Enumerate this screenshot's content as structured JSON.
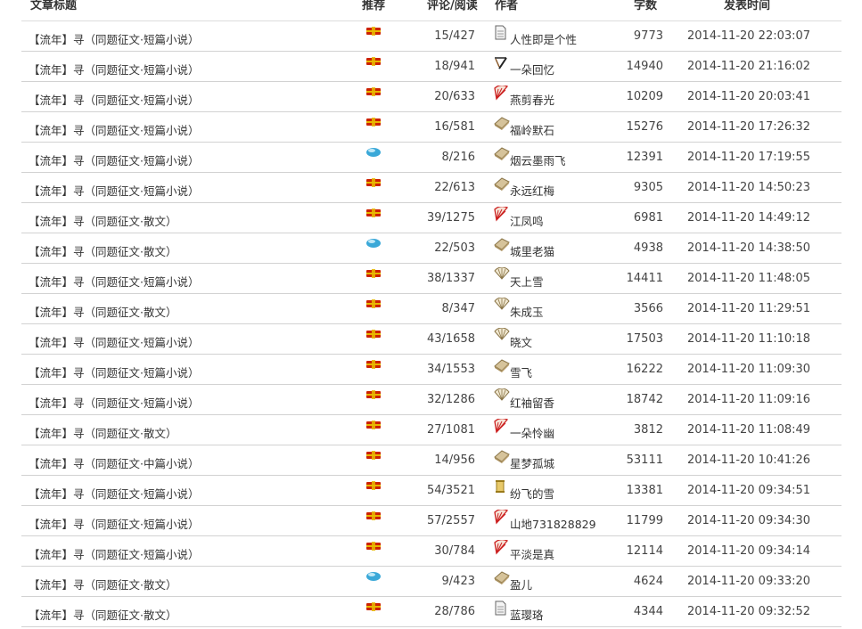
{
  "header": {
    "col_title": "文章标题",
    "col_recommend": "推荐",
    "col_comments_reads": "评论/阅读",
    "col_author": "作者",
    "col_words": "字数",
    "col_time": "发表时间"
  },
  "colors": {
    "row_border": "#d2d2d2",
    "text": "#333333",
    "recommend_red": "#cc2200",
    "recommend_gold": "#e8b800",
    "recommend_blue": "#3aa8d8"
  },
  "rows": [
    {
      "title": "【流年】寻（同题征文·短篇小说）",
      "rec": "red-bar-icon",
      "cr": "15/427",
      "author_icon": "document-icon",
      "author": "人性即是个性",
      "words": "9773",
      "time": "2014-11-20 22:03:07"
    },
    {
      "title": "【流年】寻（同题征文·短篇小说）",
      "rec": "red-bar-icon",
      "cr": "18/941",
      "author_icon": "brush-icon",
      "author": "一朵回忆",
      "words": "14940",
      "time": "2014-11-20 21:16:02"
    },
    {
      "title": "【流年】寻（同题征文·短篇小说）",
      "rec": "red-bar-icon",
      "cr": "20/633",
      "author_icon": "red-fan-icon",
      "author": "燕剪春光",
      "words": "10209",
      "time": "2014-11-20 20:03:41"
    },
    {
      "title": "【流年】寻（同题征文·短篇小说）",
      "rec": "red-bar-icon",
      "cr": "16/581",
      "author_icon": "book-icon",
      "author": "福岭默石",
      "words": "15276",
      "time": "2014-11-20 17:26:32"
    },
    {
      "title": "【流年】寻（同题征文·短篇小说）",
      "rec": "blue-gem-icon",
      "cr": "8/216",
      "author_icon": "book-icon",
      "author": "烟云墨雨飞",
      "words": "12391",
      "time": "2014-11-20 17:19:55"
    },
    {
      "title": "【流年】寻（同题征文·短篇小说）",
      "rec": "red-bar-icon",
      "cr": "22/613",
      "author_icon": "book-icon",
      "author": "永远红梅",
      "words": "9305",
      "time": "2014-11-20 14:50:23"
    },
    {
      "title": "【流年】寻（同题征文·散文）",
      "rec": "red-bar-icon",
      "cr": "39/1275",
      "author_icon": "red-fan-icon",
      "author": "江凤鸣",
      "words": "6981",
      "time": "2014-11-20 14:49:12"
    },
    {
      "title": "【流年】寻（同题征文·散文）",
      "rec": "blue-gem-icon",
      "cr": "22/503",
      "author_icon": "book-icon",
      "author": "城里老猫",
      "words": "4938",
      "time": "2014-11-20 14:38:50"
    },
    {
      "title": "【流年】寻（同题征文·短篇小说）",
      "rec": "red-bar-icon",
      "cr": "38/1337",
      "author_icon": "paper-fan-icon",
      "author": "天上雪",
      "words": "14411",
      "time": "2014-11-20 11:48:05"
    },
    {
      "title": "【流年】寻（同题征文·散文）",
      "rec": "red-bar-icon",
      "cr": "8/347",
      "author_icon": "paper-fan-icon",
      "author": "朱成玉",
      "words": "3566",
      "time": "2014-11-20 11:29:51"
    },
    {
      "title": "【流年】寻（同题征文·短篇小说）",
      "rec": "red-bar-icon",
      "cr": "43/1658",
      "author_icon": "paper-fan-icon",
      "author": "晓文",
      "words": "17503",
      "time": "2014-11-20 11:10:18"
    },
    {
      "title": "【流年】寻（同题征文·短篇小说）",
      "rec": "red-bar-icon",
      "cr": "34/1553",
      "author_icon": "book-icon",
      "author": "雪飞",
      "words": "16222",
      "time": "2014-11-20 11:09:30"
    },
    {
      "title": "【流年】寻（同题征文·短篇小说）",
      "rec": "red-bar-icon",
      "cr": "32/1286",
      "author_icon": "paper-fan-icon",
      "author": "红袖留香",
      "words": "18742",
      "time": "2014-11-20 11:09:16"
    },
    {
      "title": "【流年】寻（同题征文·散文）",
      "rec": "red-bar-icon",
      "cr": "27/1081",
      "author_icon": "red-fan-icon",
      "author": "一朵怜幽",
      "words": "3812",
      "time": "2014-11-20 11:08:49"
    },
    {
      "title": "【流年】寻（同题征文·中篇小说）",
      "rec": "red-bar-icon",
      "cr": "14/956",
      "author_icon": "book-icon",
      "author": "星梦孤城",
      "words": "53111",
      "time": "2014-11-20 10:41:26"
    },
    {
      "title": "【流年】寻（同题征文·短篇小说）",
      "rec": "red-bar-icon",
      "cr": "54/3521",
      "author_icon": "scroll-icon",
      "author": "纷飞的雪",
      "words": "13381",
      "time": "2014-11-20 09:34:51"
    },
    {
      "title": "【流年】寻（同题征文·短篇小说）",
      "rec": "red-bar-icon",
      "cr": "57/2557",
      "author_icon": "red-fan-icon",
      "author": "山地731828829",
      "words": "11799",
      "time": "2014-11-20 09:34:30"
    },
    {
      "title": "【流年】寻（同题征文·短篇小说）",
      "rec": "red-bar-icon",
      "cr": "30/784",
      "author_icon": "red-fan-icon",
      "author": "平淡是真",
      "words": "12114",
      "time": "2014-11-20 09:34:14"
    },
    {
      "title": "【流年】寻（同题征文·散文）",
      "rec": "blue-gem-icon",
      "cr": "9/423",
      "author_icon": "book-icon",
      "author": "盈儿",
      "words": "4624",
      "time": "2014-11-20 09:33:20"
    },
    {
      "title": "【流年】寻（同题征文·散文）",
      "rec": "red-bar-icon",
      "cr": "28/786",
      "author_icon": "document-icon",
      "author": "蓝璎珞",
      "words": "4344",
      "time": "2014-11-20 09:32:52"
    }
  ]
}
